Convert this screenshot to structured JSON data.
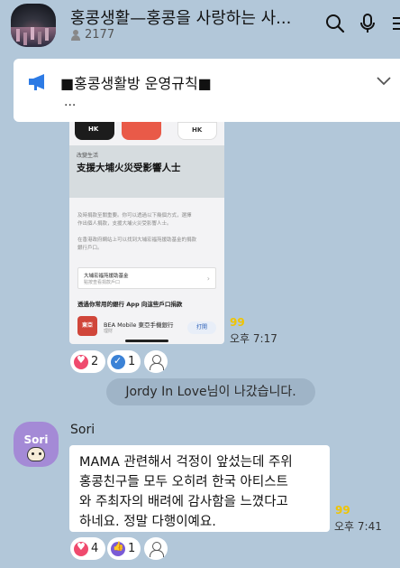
{
  "header": {
    "title": "홍콩생활—홍콩을 사랑하는 사...",
    "member_count": "2177",
    "avatar_icon": "night-city-avatar",
    "search_icon": "search-icon",
    "mic_icon": "mic-icon",
    "menu_icon": "menu-icon"
  },
  "notice": {
    "text": "■홍콩생활방 운영규칙■",
    "subtext": "...",
    "icon": "megaphone-icon",
    "icon_color": "#2d7be5"
  },
  "image_message": {
    "tiles": [
      "HK",
      "",
      "HK"
    ],
    "banner_small": "改變生活",
    "banner_title": "支援大埔火災受影響人士",
    "para1_lines": [
      "及時捐款至關重要。你可以透過以下幾個方式，選擇",
      "作出個人捐款，支援大埔火災受影響人士。"
    ],
    "para2_lines": [
      "在香港政府網站上可以找到大埔宏福苑援助基金的捐款",
      "銀行戶口。"
    ],
    "fund_title": "大埔宏福苑援助基金",
    "fund_sub": "點按查看捐款戶口",
    "fund_chevron": "›",
    "section_title": "透過你常用的銀行 App 向這些戶口捐款",
    "bank_logo": "東亞",
    "bank_name": "BEA Mobile 東亞手機銀行",
    "bank_sub": "理財",
    "open_label": "打開",
    "unread": "99",
    "time": "오후 7:17",
    "reactions": [
      {
        "type": "heart",
        "count": "2",
        "color": "#ef4a6e"
      },
      {
        "type": "check",
        "count": "1",
        "color": "#3b82d6"
      }
    ]
  },
  "system_message": "Jordy In Love님이 나갔습니다.",
  "sori_message": {
    "sender": "Sori",
    "avatar_label": "Sori",
    "lines": [
      "MAMA 관련해서 걱정이 앞섰는데 주위",
      "홍콩친구들 모두 오히려 한국 아티스트",
      "와 주최자의 배려에 감사함을 느꼈다고",
      "하네요. 정말 다행이예요."
    ],
    "unread": "99",
    "time": "오후 7:41",
    "reactions": [
      {
        "type": "heart",
        "count": "4",
        "color": "#ef4a6e"
      },
      {
        "type": "thumb",
        "count": "1",
        "color": "#7a5bd6"
      }
    ]
  },
  "colors": {
    "background": "#b2c7d9",
    "bubble": "#ffffff",
    "unread": "#f0c400"
  }
}
